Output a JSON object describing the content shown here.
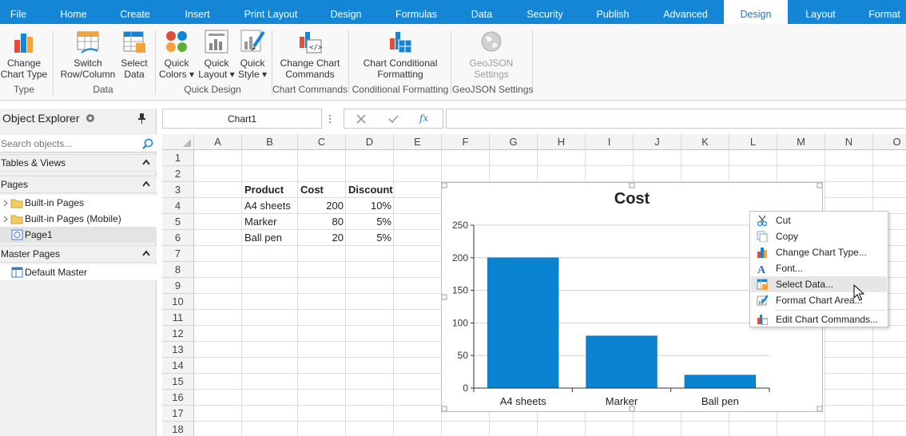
{
  "tabs": [
    "File",
    "Home",
    "Create",
    "Insert",
    "Print Layout",
    "Design",
    "Formulas",
    "Data",
    "Security",
    "Publish",
    "Advanced",
    "Design",
    "Layout",
    "Format"
  ],
  "active_tab_index": 11,
  "ribbon": {
    "buttons": [
      {
        "label1": "Change",
        "label2": "Chart Type",
        "icon": "bar-chart-icon"
      },
      {
        "label1": "Switch",
        "label2": "Row/Column",
        "icon": "switch-row-column-icon"
      },
      {
        "label1": "Select",
        "label2": "Data",
        "icon": "select-data-icon"
      },
      {
        "label1": "Quick",
        "label2": "Colors ▾",
        "icon": "palette-icon"
      },
      {
        "label1": "Quick",
        "label2": "Layout ▾",
        "icon": "chart-layout-icon"
      },
      {
        "label1": "Quick",
        "label2": "Style ▾",
        "icon": "brush-icon"
      },
      {
        "label1": "Change Chart",
        "label2": "Commands",
        "icon": "chart-commands-icon"
      },
      {
        "label1": "Chart Conditional",
        "label2": "Formatting",
        "icon": "conditional-format-icon"
      },
      {
        "label1": "GeoJSON",
        "label2": "Settings",
        "icon": "globe-icon"
      }
    ],
    "groups": [
      "Type",
      "Data",
      "Quick Design",
      "Chart Commands",
      "Conditional Formatting",
      "GeoJSON Settings"
    ]
  },
  "explorer": {
    "title": "Object Explorer",
    "search_placeholder": "Search objects...",
    "sections": {
      "tables_views": "Tables & Views",
      "pages": "Pages",
      "master_pages": "Master Pages"
    },
    "pages_items": [
      "Built-in Pages",
      "Built-in Pages (Mobile)",
      "Page1"
    ],
    "master_items": [
      "Default Master"
    ]
  },
  "formula_bar": {
    "name_box": "Chart1",
    "fx": "fx",
    "value": ""
  },
  "grid": {
    "columns": [
      "A",
      "B",
      "C",
      "D",
      "E",
      "F",
      "G",
      "H",
      "I",
      "J",
      "K",
      "L",
      "M",
      "N",
      "O"
    ],
    "rows": [
      "1",
      "2",
      "3",
      "4",
      "5",
      "6",
      "7",
      "8",
      "9",
      "10",
      "11",
      "12",
      "13",
      "14",
      "15",
      "16",
      "17",
      "18"
    ],
    "headers": [
      "Product",
      "Cost",
      "Discount"
    ],
    "data": [
      [
        "A4 sheets",
        "200",
        "10%"
      ],
      [
        "Marker",
        "80",
        "5%"
      ],
      [
        "Ball pen",
        "20",
        "5%"
      ]
    ]
  },
  "chart_data": {
    "type": "bar",
    "title": "Cost",
    "categories": [
      "A4 sheets",
      "Marker",
      "Ball pen"
    ],
    "values": [
      200,
      80,
      20
    ],
    "ylim": [
      0,
      250
    ],
    "yticks": [
      "0",
      "50",
      "100",
      "150",
      "200",
      "250"
    ],
    "grid": true,
    "bar_color": "#0a84d0"
  },
  "context_menu": {
    "items": [
      {
        "label": "Cut",
        "icon": "scissors-icon"
      },
      {
        "label": "Copy",
        "icon": "copy-icon"
      },
      {
        "label": "Change Chart Type...",
        "icon": "bar-chart-icon"
      },
      {
        "label": "Font...",
        "icon": "font-icon"
      },
      {
        "label": "Select Data...",
        "icon": "select-data-icon"
      },
      {
        "label": "Format Chart Area...",
        "icon": "format-area-icon"
      },
      {
        "label": "Edit Chart Commands...",
        "icon": "chart-commands-icon"
      }
    ],
    "highlighted_index": 4
  },
  "colors": {
    "accent": "#1586d6",
    "bar": "#0a84d0"
  }
}
